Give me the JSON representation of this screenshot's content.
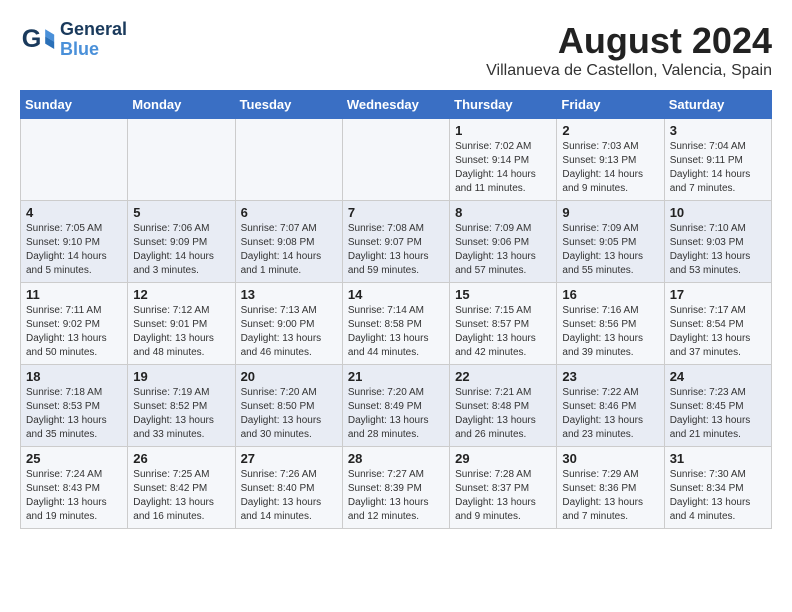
{
  "header": {
    "logo_line1": "General",
    "logo_line2": "Blue",
    "month": "August 2024",
    "location": "Villanueva de Castellon, Valencia, Spain"
  },
  "weekdays": [
    "Sunday",
    "Monday",
    "Tuesday",
    "Wednesday",
    "Thursday",
    "Friday",
    "Saturday"
  ],
  "weeks": [
    [
      {
        "day": "",
        "info": ""
      },
      {
        "day": "",
        "info": ""
      },
      {
        "day": "",
        "info": ""
      },
      {
        "day": "",
        "info": ""
      },
      {
        "day": "1",
        "info": "Sunrise: 7:02 AM\nSunset: 9:14 PM\nDaylight: 14 hours and 11 minutes."
      },
      {
        "day": "2",
        "info": "Sunrise: 7:03 AM\nSunset: 9:13 PM\nDaylight: 14 hours and 9 minutes."
      },
      {
        "day": "3",
        "info": "Sunrise: 7:04 AM\nSunset: 9:11 PM\nDaylight: 14 hours and 7 minutes."
      }
    ],
    [
      {
        "day": "4",
        "info": "Sunrise: 7:05 AM\nSunset: 9:10 PM\nDaylight: 14 hours and 5 minutes."
      },
      {
        "day": "5",
        "info": "Sunrise: 7:06 AM\nSunset: 9:09 PM\nDaylight: 14 hours and 3 minutes."
      },
      {
        "day": "6",
        "info": "Sunrise: 7:07 AM\nSunset: 9:08 PM\nDaylight: 14 hours and 1 minute."
      },
      {
        "day": "7",
        "info": "Sunrise: 7:08 AM\nSunset: 9:07 PM\nDaylight: 13 hours and 59 minutes."
      },
      {
        "day": "8",
        "info": "Sunrise: 7:09 AM\nSunset: 9:06 PM\nDaylight: 13 hours and 57 minutes."
      },
      {
        "day": "9",
        "info": "Sunrise: 7:09 AM\nSunset: 9:05 PM\nDaylight: 13 hours and 55 minutes."
      },
      {
        "day": "10",
        "info": "Sunrise: 7:10 AM\nSunset: 9:03 PM\nDaylight: 13 hours and 53 minutes."
      }
    ],
    [
      {
        "day": "11",
        "info": "Sunrise: 7:11 AM\nSunset: 9:02 PM\nDaylight: 13 hours and 50 minutes."
      },
      {
        "day": "12",
        "info": "Sunrise: 7:12 AM\nSunset: 9:01 PM\nDaylight: 13 hours and 48 minutes."
      },
      {
        "day": "13",
        "info": "Sunrise: 7:13 AM\nSunset: 9:00 PM\nDaylight: 13 hours and 46 minutes."
      },
      {
        "day": "14",
        "info": "Sunrise: 7:14 AM\nSunset: 8:58 PM\nDaylight: 13 hours and 44 minutes."
      },
      {
        "day": "15",
        "info": "Sunrise: 7:15 AM\nSunset: 8:57 PM\nDaylight: 13 hours and 42 minutes."
      },
      {
        "day": "16",
        "info": "Sunrise: 7:16 AM\nSunset: 8:56 PM\nDaylight: 13 hours and 39 minutes."
      },
      {
        "day": "17",
        "info": "Sunrise: 7:17 AM\nSunset: 8:54 PM\nDaylight: 13 hours and 37 minutes."
      }
    ],
    [
      {
        "day": "18",
        "info": "Sunrise: 7:18 AM\nSunset: 8:53 PM\nDaylight: 13 hours and 35 minutes."
      },
      {
        "day": "19",
        "info": "Sunrise: 7:19 AM\nSunset: 8:52 PM\nDaylight: 13 hours and 33 minutes."
      },
      {
        "day": "20",
        "info": "Sunrise: 7:20 AM\nSunset: 8:50 PM\nDaylight: 13 hours and 30 minutes."
      },
      {
        "day": "21",
        "info": "Sunrise: 7:20 AM\nSunset: 8:49 PM\nDaylight: 13 hours and 28 minutes."
      },
      {
        "day": "22",
        "info": "Sunrise: 7:21 AM\nSunset: 8:48 PM\nDaylight: 13 hours and 26 minutes."
      },
      {
        "day": "23",
        "info": "Sunrise: 7:22 AM\nSunset: 8:46 PM\nDaylight: 13 hours and 23 minutes."
      },
      {
        "day": "24",
        "info": "Sunrise: 7:23 AM\nSunset: 8:45 PM\nDaylight: 13 hours and 21 minutes."
      }
    ],
    [
      {
        "day": "25",
        "info": "Sunrise: 7:24 AM\nSunset: 8:43 PM\nDaylight: 13 hours and 19 minutes."
      },
      {
        "day": "26",
        "info": "Sunrise: 7:25 AM\nSunset: 8:42 PM\nDaylight: 13 hours and 16 minutes."
      },
      {
        "day": "27",
        "info": "Sunrise: 7:26 AM\nSunset: 8:40 PM\nDaylight: 13 hours and 14 minutes."
      },
      {
        "day": "28",
        "info": "Sunrise: 7:27 AM\nSunset: 8:39 PM\nDaylight: 13 hours and 12 minutes."
      },
      {
        "day": "29",
        "info": "Sunrise: 7:28 AM\nSunset: 8:37 PM\nDaylight: 13 hours and 9 minutes."
      },
      {
        "day": "30",
        "info": "Sunrise: 7:29 AM\nSunset: 8:36 PM\nDaylight: 13 hours and 7 minutes."
      },
      {
        "day": "31",
        "info": "Sunrise: 7:30 AM\nSunset: 8:34 PM\nDaylight: 13 hours and 4 minutes."
      }
    ]
  ]
}
